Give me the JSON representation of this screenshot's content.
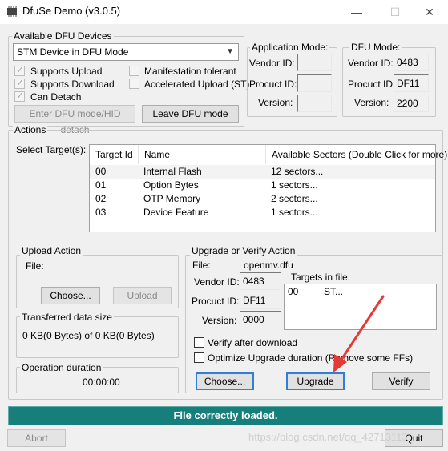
{
  "window": {
    "title": "DfuSe Demo (v3.0.5)",
    "minimize_glyph": "—",
    "maximize_glyph": "☐",
    "close_glyph": "✕"
  },
  "devices": {
    "legend": "Available DFU Devices",
    "selected": "STM Device in DFU Mode",
    "checkboxes": {
      "supports_upload": "Supports Upload",
      "supports_download": "Supports Download",
      "can_detach": "Can Detach",
      "manifestation_tolerant": "Manifestation tolerant",
      "accelerated_upload": "Accelerated Upload (ST)"
    },
    "enter_dfu_button": "Enter DFU mode/HID detach",
    "leave_dfu_button": "Leave DFU mode"
  },
  "app_mode": {
    "legend": "Application Mode:",
    "vendor_label": "Vendor ID:",
    "product_label": "Procuct ID:",
    "version_label": "Version:",
    "vendor": "",
    "product": "",
    "version": ""
  },
  "dfu_mode": {
    "legend": "DFU Mode:",
    "vendor_label": "Vendor ID:",
    "product_label": "Procuct ID:",
    "version_label": "Version:",
    "vendor": "0483",
    "product": "DF11",
    "version": "2200"
  },
  "actions": {
    "legend": "Actions",
    "select_targets_label": "Select Target(s):",
    "columns": [
      "Target Id",
      "Name",
      "Available Sectors (Double Click for more)"
    ],
    "rows": [
      {
        "id": "00",
        "name": "Internal Flash",
        "sectors": "12 sectors..."
      },
      {
        "id": "01",
        "name": "Option Bytes",
        "sectors": "1 sectors..."
      },
      {
        "id": "02",
        "name": "OTP Memory",
        "sectors": "2 sectors..."
      },
      {
        "id": "03",
        "name": "Device Feature",
        "sectors": "1 sectors..."
      }
    ]
  },
  "upload": {
    "legend": "Upload Action",
    "file_label": "File:",
    "choose_button": "Choose...",
    "upload_button": "Upload"
  },
  "transferred": {
    "legend": "Transferred data size",
    "value": "0 KB(0 Bytes) of 0 KB(0 Bytes)"
  },
  "duration": {
    "legend": "Operation duration",
    "value": "00:00:00"
  },
  "upgrade": {
    "legend": "Upgrade or Verify Action",
    "file_label": "File:",
    "file_name": "openmv.dfu",
    "vendor_label": "Vendor ID:",
    "product_label": "Procuct ID:",
    "version_label": "Version:",
    "vendor": "0483",
    "product": "DF11",
    "version": "0000",
    "targets_label": "Targets in file:",
    "targets": [
      {
        "id": "00",
        "name": "ST..."
      }
    ],
    "verify_after_download": "Verify after download",
    "optimize_upgrade": "Optimize Upgrade duration (Remove some FFs)",
    "choose_button": "Choose...",
    "upgrade_button": "Upgrade",
    "verify_button": "Verify"
  },
  "status": "File correctly loaded.",
  "abort_button": "Abort",
  "quit_button": "Quit",
  "watermark": "https://blog.csdn.net/qq_42713113",
  "colors": {
    "status_bg": "#167f7b",
    "arrow": "#e53935",
    "focus": "#2f7fd8"
  }
}
